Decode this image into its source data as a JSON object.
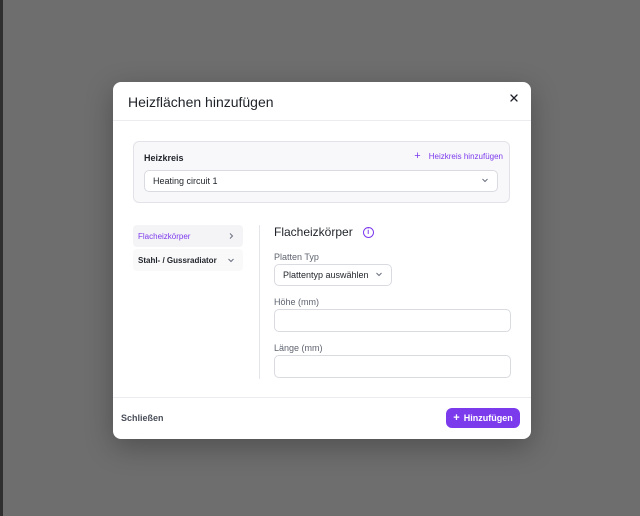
{
  "modal": {
    "title": "Heizflächen hinzufügen",
    "close_icon": "close-icon"
  },
  "heizkreis": {
    "label": "Heizkreis",
    "add_label": "Heizkreis hinzufügen",
    "add_icon": "plus-icon",
    "selected_value": "Heating circuit 1",
    "select_icon": "chevron-down-icon"
  },
  "nav": {
    "items": [
      {
        "label": "Flacheizkörper",
        "icon": "chevron-right-icon",
        "active": true
      },
      {
        "label": "Stahl- / Gussradiator",
        "icon": "chevron-down-icon",
        "active": false
      }
    ]
  },
  "form": {
    "section_title": "Flacheizkörper",
    "info_icon": "info-icon",
    "platten_typ_label": "Platten Typ",
    "platten_typ_placeholder": "Plattentyp auswählen",
    "hoehe_label": "Höhe (mm)",
    "hoehe_value": "",
    "laenge_label": "Länge (mm)",
    "laenge_value": ""
  },
  "footer": {
    "close_label": "Schließen",
    "add_label": "Hinzufügen",
    "add_icon": "plus-icon"
  },
  "colors": {
    "accent": "#7c3aed",
    "backdrop": "#6e6e6e",
    "surface": "#ffffff"
  }
}
